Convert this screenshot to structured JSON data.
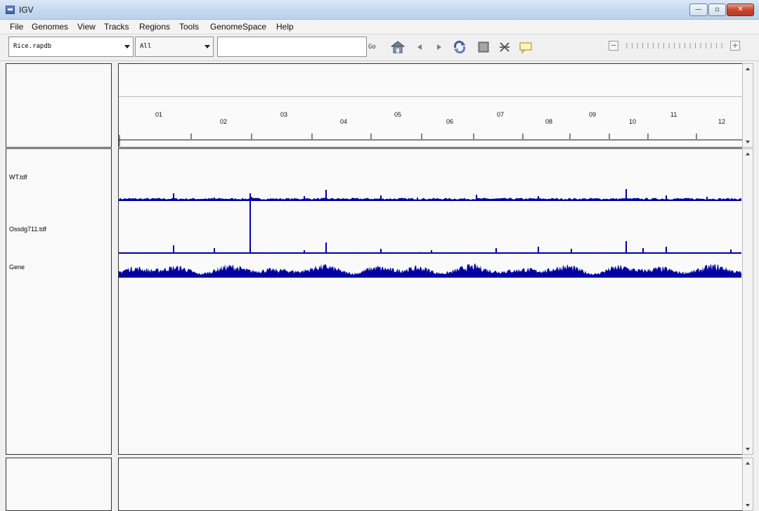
{
  "window": {
    "title": "IGV",
    "minimize_glyph": "—",
    "maximize_glyph": "▫",
    "close_glyph": "✕"
  },
  "menu": [
    "File",
    "Genomes",
    "View",
    "Tracks",
    "Regions",
    "Tools",
    "GenomeSpace",
    "Help"
  ],
  "toolbar": {
    "genome": "Rice.rapdb",
    "chromosome": "All",
    "locus": "",
    "go_label": "Go",
    "icons": [
      "home-icon",
      "back-icon",
      "forward-icon",
      "refresh-icon",
      "resize-icon",
      "select-region-icon",
      "popup-info-icon"
    ],
    "zoom_minus": "−",
    "zoom_plus": "+"
  },
  "ruler": {
    "chromosomes": [
      "01",
      "02",
      "03",
      "04",
      "05",
      "06",
      "07",
      "08",
      "09",
      "10",
      "11",
      "12"
    ]
  },
  "tracks": [
    {
      "name": "WT.tdf"
    },
    {
      "name": "Ossdg711.tdf"
    },
    {
      "name": "Gene"
    }
  ],
  "colors": {
    "track": "#0000a5",
    "panel_border": "#333333",
    "background": "#fafafa"
  }
}
